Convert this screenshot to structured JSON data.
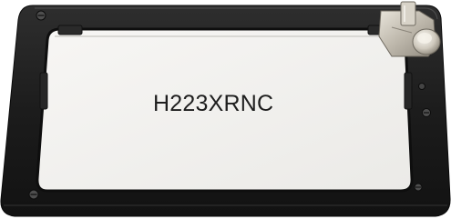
{
  "product": {
    "part_number": "H223XRNC"
  },
  "colors": {
    "frame": "#1f1f1f",
    "frame_edge": "#3a3a3a",
    "panel": "#f2f1ef",
    "screw": "#5a5a5a",
    "latch_metal": "#cfcac0"
  },
  "icons": {
    "screws": [
      "screw-icon",
      "screw-icon",
      "screw-icon",
      "screw-icon"
    ],
    "latch": "latch-clip-icon"
  }
}
